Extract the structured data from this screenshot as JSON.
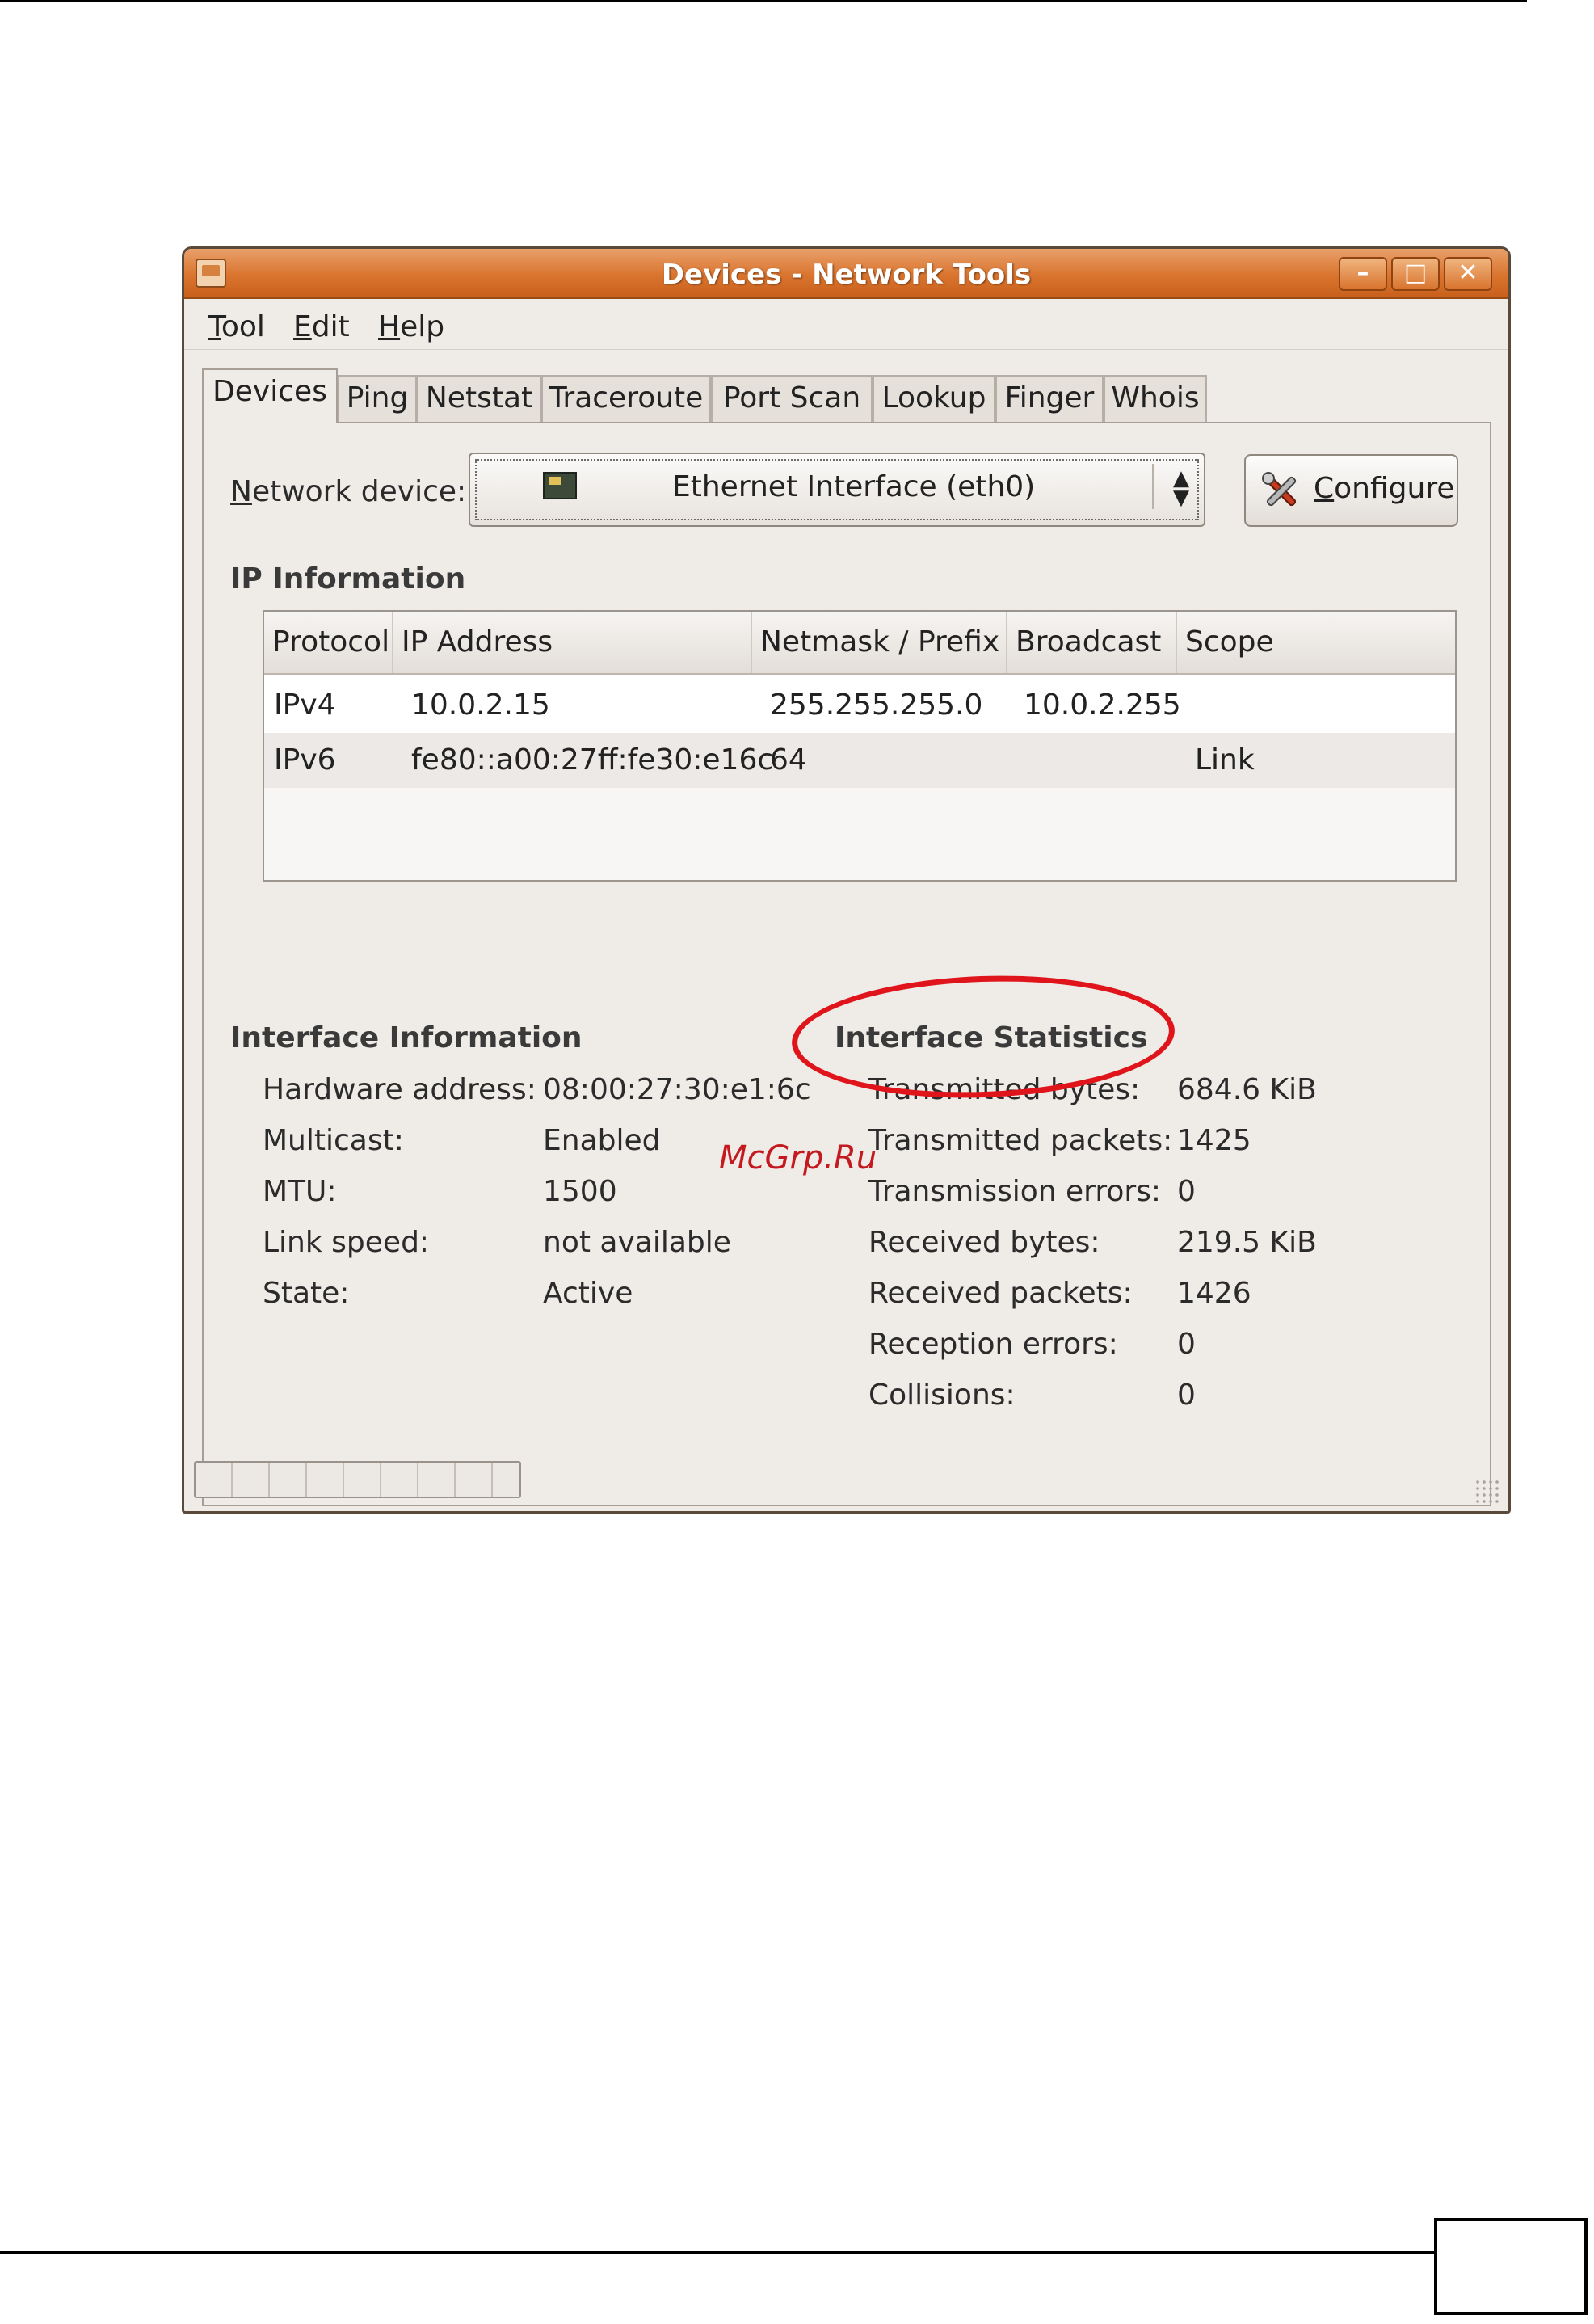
{
  "window": {
    "title": "Devices - Network Tools",
    "controls": {
      "minimize": "–",
      "maximize": "□",
      "close": "✕"
    }
  },
  "menu": [
    {
      "label_u": "T",
      "label_rest": "ool"
    },
    {
      "label_u": "E",
      "label_rest": "dit"
    },
    {
      "label_u": "H",
      "label_rest": "elp"
    }
  ],
  "tabs": [
    "Devices",
    "Ping",
    "Netstat",
    "Traceroute",
    "Port Scan",
    "Lookup",
    "Finger",
    "Whois"
  ],
  "device": {
    "label_u": "N",
    "label_rest": "etwork device:",
    "selected": "Ethernet Interface (eth0)",
    "arrows": "▲\n▼",
    "configure_u": "C",
    "configure_rest": "onfigure"
  },
  "ip_info": {
    "heading": "IP Information",
    "columns": [
      "Protocol",
      "IP Address",
      "Netmask / Prefix",
      "Broadcast",
      "Scope"
    ],
    "rows": [
      [
        "IPv4",
        "10.0.2.15",
        "255.255.255.0",
        "10.0.2.255",
        ""
      ],
      [
        "IPv6",
        "fe80::a00:27ff:fe30:e16c",
        "64",
        "",
        "Link"
      ]
    ]
  },
  "interface_info": {
    "heading": "Interface Information",
    "items": [
      {
        "label": "Hardware address:",
        "value": "08:00:27:30:e1:6c"
      },
      {
        "label": "Multicast:",
        "value": "Enabled"
      },
      {
        "label": "MTU:",
        "value": "1500"
      },
      {
        "label": "Link speed:",
        "value": "not available"
      },
      {
        "label": "State:",
        "value": "Active"
      }
    ]
  },
  "interface_stats": {
    "heading": "Interface Statistics",
    "items": [
      {
        "label": "Transmitted bytes:",
        "value": "684.6 KiB"
      },
      {
        "label": "Transmitted packets:",
        "value": "1425"
      },
      {
        "label": "Transmission errors:",
        "value": "0"
      },
      {
        "label": "Received bytes:",
        "value": "219.5 KiB"
      },
      {
        "label": "Received packets:",
        "value": "1426"
      },
      {
        "label": "Reception errors:",
        "value": "0"
      },
      {
        "label": "Collisions:",
        "value": "0"
      }
    ]
  },
  "overlay": {
    "watermark": "McGrp.Ru",
    "highlight_color": "#e0141b"
  }
}
